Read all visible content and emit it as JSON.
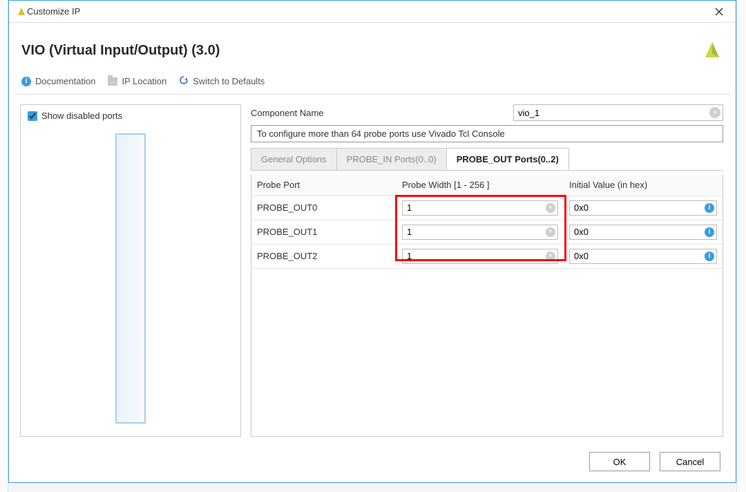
{
  "window": {
    "title": "Customize IP"
  },
  "header": {
    "title": "VIO (Virtual Input/Output) (3.0)"
  },
  "toolbar": {
    "documentation_label": "Documentation",
    "ip_location_label": "IP Location",
    "switch_defaults_label": "Switch to Defaults"
  },
  "left": {
    "show_disabled_label": "Show disabled ports",
    "show_disabled_checked": true
  },
  "component_name": {
    "label": "Component Name",
    "value": "vio_1"
  },
  "info_text": "To configure more than 64 probe ports use Vivado Tcl Console",
  "tabs": {
    "general": "General Options",
    "probe_in": "PROBE_IN Ports(0..0)",
    "probe_out": "PROBE_OUT Ports(0..2)",
    "active_index": 2
  },
  "table": {
    "headers": [
      "Probe Port",
      "Probe Width [1 - 256 ]",
      "Initial Value (in hex)"
    ],
    "rows": [
      {
        "port": "PROBE_OUT0",
        "width": "1",
        "initial": "0x0"
      },
      {
        "port": "PROBE_OUT1",
        "width": "1",
        "initial": "0x0"
      },
      {
        "port": "PROBE_OUT2",
        "width": "1",
        "initial": "0x0"
      }
    ]
  },
  "footer": {
    "ok_label": "OK",
    "cancel_label": "Cancel"
  }
}
